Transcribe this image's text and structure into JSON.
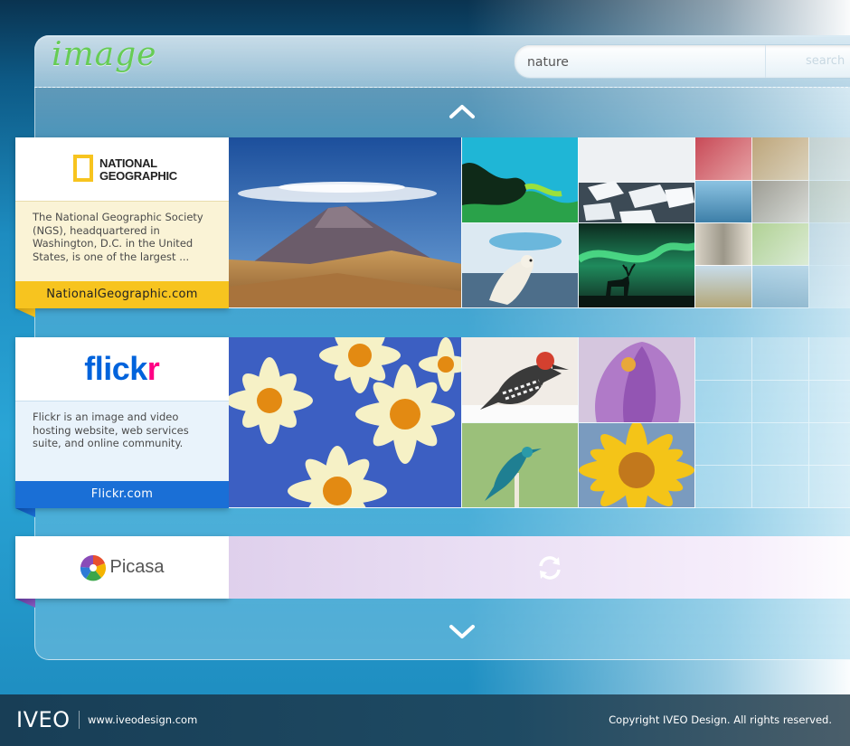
{
  "header": {
    "title": "image",
    "search_value": "nature",
    "search_button_label": "search"
  },
  "nav": {
    "up_icon": "chevron-up-icon",
    "down_icon": "chevron-down-icon"
  },
  "sources": [
    {
      "id": "natgeo",
      "logo_text_line1": "NATIONAL",
      "logo_text_line2": "GEOGRAPHIC",
      "description": "The National Geographic Society (NGS), headquartered in Washington, D.C. in the United States, is one of the largest ...",
      "link_label": "NationalGeographic.com",
      "accent_color": "#f7c41f",
      "desc_bg": "#faf3d6"
    },
    {
      "id": "flickr",
      "logo_text_a": "flick",
      "logo_text_b": "r",
      "description": "Flickr is an image and video hosting website, web services suite, and online community.",
      "link_label": "Flickr.com",
      "accent_color": "#1a6fd6",
      "desc_bg": "#e9f3fb"
    },
    {
      "id": "picasa",
      "logo_text": "Picasa",
      "status_icon": "refresh-icon",
      "accent_color": "#8a5cc2"
    }
  ],
  "footer": {
    "brand": "IVEO",
    "url": "www.iveodesign.com",
    "copyright": "Copyright IVEO Design. All rights reserved."
  }
}
